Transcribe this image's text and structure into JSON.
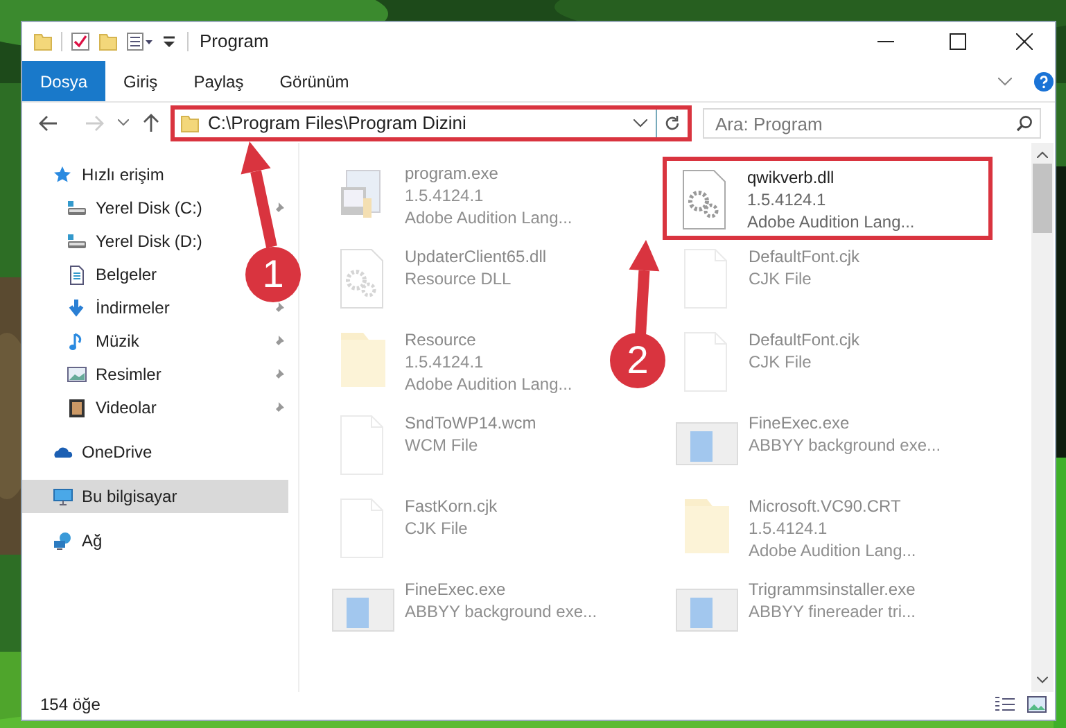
{
  "window": {
    "title": "Program"
  },
  "ribbon_tabs": [
    {
      "label": "Dosya",
      "selected": true
    },
    {
      "label": "Giriş",
      "selected": false
    },
    {
      "label": "Paylaş",
      "selected": false
    },
    {
      "label": "Görünüm",
      "selected": false
    }
  ],
  "address_bar": {
    "path": "C:\\Program Files\\Program Dizini",
    "highlighted": true
  },
  "search": {
    "placeholder": "Ara: Program"
  },
  "sidebar": {
    "items": [
      {
        "label": "Hızlı erişim",
        "kind": "star",
        "selected": false,
        "children": [
          {
            "label": "Yerel Disk (C:)",
            "kind": "disk",
            "pinned": true,
            "selected": false
          },
          {
            "label": "Yerel Disk (D:)",
            "kind": "disk",
            "pinned": false,
            "selected": false
          },
          {
            "label": "Belgeler",
            "kind": "document",
            "pinned": false,
            "selected": false
          },
          {
            "label": "İndirmeler",
            "kind": "download",
            "pinned": true,
            "selected": false
          },
          {
            "label": "Müzik",
            "kind": "music",
            "pinned": true,
            "selected": false
          },
          {
            "label": "Resimler",
            "kind": "pictures",
            "pinned": true,
            "selected": false
          },
          {
            "label": "Videolar",
            "kind": "video",
            "pinned": true,
            "selected": false
          }
        ]
      },
      {
        "label": "OneDrive",
        "kind": "cloud",
        "selected": false
      },
      {
        "label": "Bu bilgisayar",
        "kind": "computer",
        "selected": true
      },
      {
        "label": "Ağ",
        "kind": "network",
        "selected": false
      }
    ]
  },
  "files": [
    {
      "name": "program.exe",
      "details": [
        "1.5.4124.1",
        "Adobe Audition Lang..."
      ],
      "kind": "program",
      "highlighted": false
    },
    {
      "name": "qwikverb.dll",
      "details": [
        "1.5.4124.1",
        "Adobe Audition Lang..."
      ],
      "kind": "dll",
      "highlighted": true
    },
    {
      "name": "UpdaterClient65.dll",
      "details": [
        "Resource DLL"
      ],
      "kind": "dll",
      "highlighted": false
    },
    {
      "name": "DefaultFont.cjk",
      "details": [
        "CJK File"
      ],
      "kind": "file",
      "highlighted": false
    },
    {
      "name": "Resource",
      "details": [
        "1.5.4124.1",
        "Adobe Audition Lang..."
      ],
      "kind": "folder",
      "highlighted": false
    },
    {
      "name": "DefaultFont.cjk",
      "details": [
        "CJK File"
      ],
      "kind": "file",
      "highlighted": false
    },
    {
      "name": "SndToWP14.wcm",
      "details": [
        "WCM File"
      ],
      "kind": "file",
      "highlighted": false
    },
    {
      "name": "FineExec.exe",
      "details": [
        "ABBYY background exe..."
      ],
      "kind": "app",
      "highlighted": false
    },
    {
      "name": "FastKorn.cjk",
      "details": [
        "CJK File"
      ],
      "kind": "file",
      "highlighted": false
    },
    {
      "name": "Microsoft.VC90.CRT",
      "details": [
        "1.5.4124.1",
        "Adobe Audition Lang..."
      ],
      "kind": "folder",
      "highlighted": false
    },
    {
      "name": "FineExec.exe",
      "details": [
        "ABBYY background exe..."
      ],
      "kind": "app",
      "highlighted": false
    },
    {
      "name": "Trigrammsinstaller.exe",
      "details": [
        "ABBYY finereader tri..."
      ],
      "kind": "app",
      "highlighted": false
    }
  ],
  "status_bar": {
    "count": "154 öğe"
  },
  "annotations": [
    {
      "number": "1"
    },
    {
      "number": "2"
    }
  ]
}
